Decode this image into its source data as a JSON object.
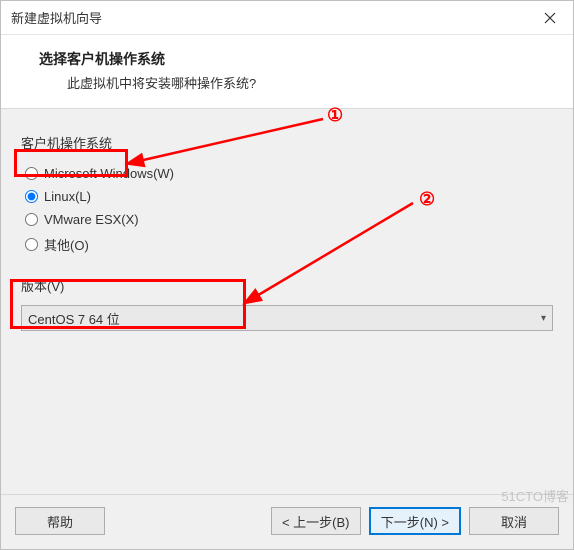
{
  "window": {
    "title": "新建虚拟机向导"
  },
  "header": {
    "title": "选择客户机操作系统",
    "subtitle": "此虚拟机中将安装哪种操作系统?"
  },
  "guest_os": {
    "label": "客户机操作系统",
    "options": [
      {
        "label": "Microsoft Windows(W)",
        "selected": false
      },
      {
        "label": "Linux(L)",
        "selected": true
      },
      {
        "label": "VMware ESX(X)",
        "selected": false
      },
      {
        "label": "其他(O)",
        "selected": false
      }
    ]
  },
  "version": {
    "label": "版本(V)",
    "selected": "CentOS 7 64 位"
  },
  "buttons": {
    "help": "帮助",
    "back": "< 上一步(B)",
    "next": "下一步(N) >",
    "cancel": "取消"
  },
  "annotations": {
    "one": "①",
    "two": "②"
  },
  "watermark": "51CTO博客"
}
